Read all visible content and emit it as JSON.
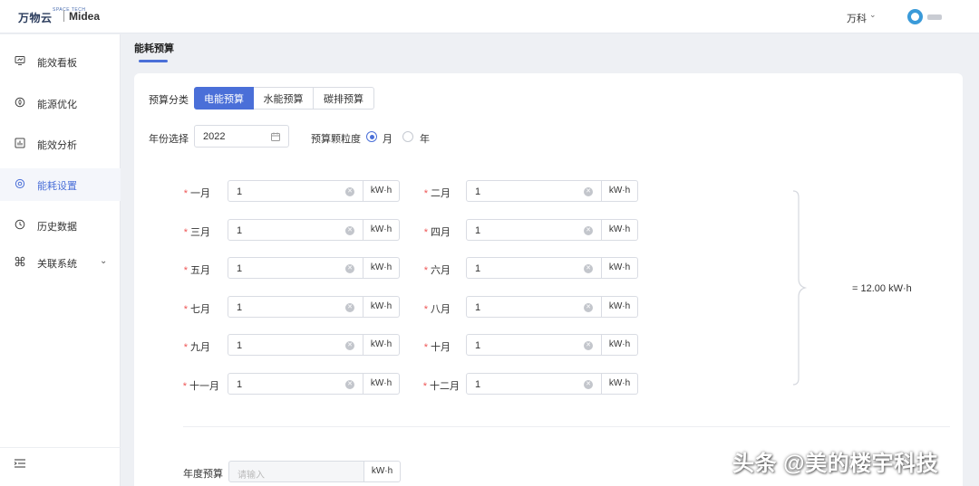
{
  "header": {
    "logo_text": "万物云",
    "logo_sup": "SPACE TECH",
    "brand": "Midea",
    "user_name": "万科"
  },
  "sidebar": {
    "items": [
      {
        "label": "能效看板",
        "icon": "monitor-icon",
        "active": false
      },
      {
        "label": "能源优化",
        "icon": "leaf-icon",
        "active": false
      },
      {
        "label": "能效分析",
        "icon": "bar-chart-icon",
        "active": false
      },
      {
        "label": "能耗设置",
        "icon": "settings-icon",
        "active": true
      },
      {
        "label": "历史数据",
        "icon": "clock-icon",
        "active": false
      },
      {
        "label": "关联系统",
        "icon": "command-icon",
        "active": false
      }
    ]
  },
  "page": {
    "title": "能耗预算"
  },
  "form": {
    "category_label": "预算分类",
    "categories": [
      "电能预算",
      "水能预算",
      "碳排预算"
    ],
    "active_category": "电能预算",
    "year_label": "年份选择",
    "year_value": "2022",
    "granularity_label": "预算颗粒度",
    "granularity_options": [
      "月",
      "年"
    ],
    "granularity_selected": "月",
    "unit": "kW·h",
    "months": [
      {
        "label": "一月",
        "value": "1"
      },
      {
        "label": "二月",
        "value": "1"
      },
      {
        "label": "三月",
        "value": "1"
      },
      {
        "label": "四月",
        "value": "1"
      },
      {
        "label": "五月",
        "value": "1"
      },
      {
        "label": "六月",
        "value": "1"
      },
      {
        "label": "七月",
        "value": "1"
      },
      {
        "label": "八月",
        "value": "1"
      },
      {
        "label": "九月",
        "value": "1"
      },
      {
        "label": "十月",
        "value": "1"
      },
      {
        "label": "十一月",
        "value": "1"
      },
      {
        "label": "十二月",
        "value": "1"
      }
    ],
    "total": "= 12.00 kW·h",
    "annual_label": "年度预算",
    "annual_placeholder": "请输入"
  },
  "watermark": "头条 @美的楼宇科技",
  "colors": {
    "accent": "#4a6fd8",
    "required": "#e55555",
    "background": "#eef0f4"
  }
}
